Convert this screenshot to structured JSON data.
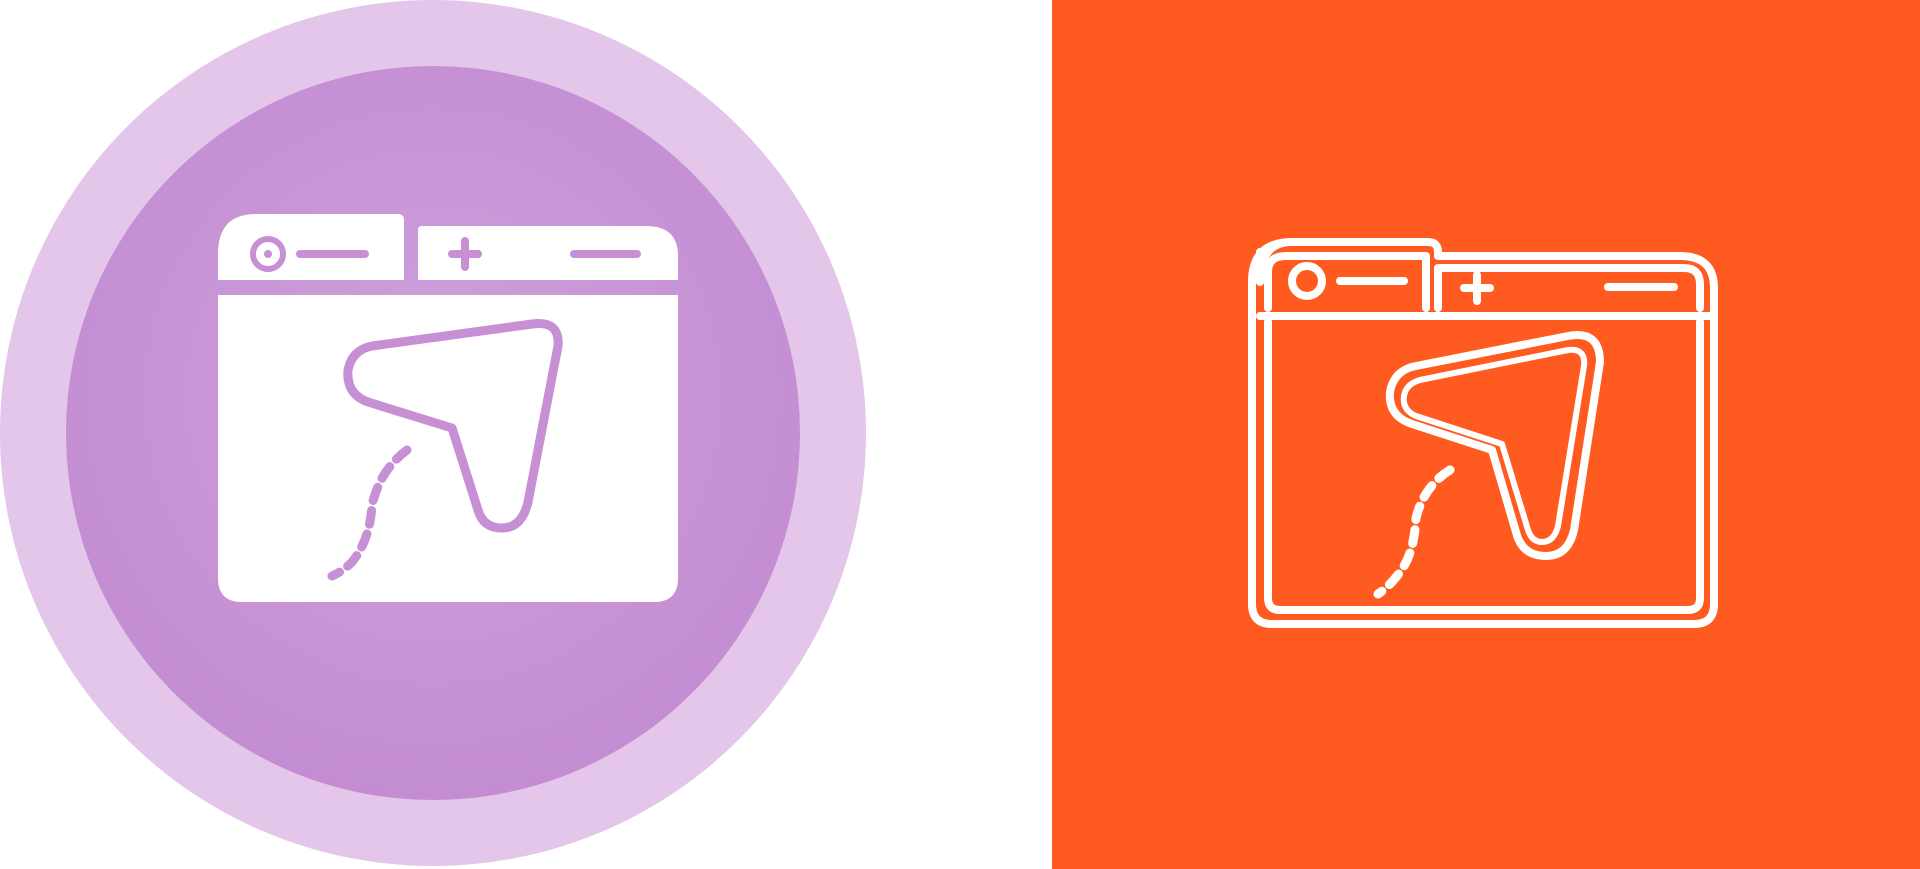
{
  "icons": {
    "left": {
      "name": "browser-navigation-glyph-icon",
      "style": "glyph",
      "outer_circle_color": "#e4c6ea",
      "inner_circle_color": "#c78fd4",
      "glyph_color": "#ffffff",
      "accent_color": "#c78fd4"
    },
    "right": {
      "name": "browser-navigation-line-icon",
      "style": "line",
      "background_color": "#ff5a1f",
      "line_color": "#ffffff"
    }
  }
}
